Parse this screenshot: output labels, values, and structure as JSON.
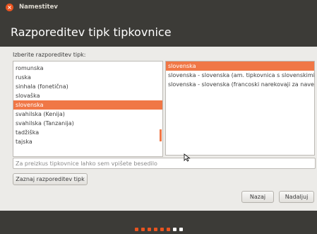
{
  "window": {
    "title": "Namestitev"
  },
  "page": {
    "title": "Razporeditev tipk tipkovnice",
    "prompt": "Izberite razporeditev tipk:"
  },
  "layouts": [
    "romunska",
    "ruska",
    "sinhala (fonetična)",
    "slovaška",
    "slovenska",
    "svahilska (Kenija)",
    "svahilska (Tanzanija)",
    "tadžiška",
    "tajska"
  ],
  "selected_layout": "slovenska",
  "variants": [
    "slovenska",
    "slovenska - slovenska (am. tipkovnica s slovenskimi č",
    "slovenska - slovenska (francoski narekovaji za navedl"
  ],
  "selected_variant": "slovenska",
  "test_field": {
    "placeholder": "Za preizkus tipkovnice lahko sem vpišete besedilo"
  },
  "buttons": {
    "detect": "Zaznaj razporeditev tipk",
    "back": "Nazaj",
    "next": "Nadaljuj"
  },
  "progress": {
    "total": 8,
    "completed": 6
  },
  "colors": {
    "accent": "#f07746",
    "dark": "#3c3b37",
    "dot_done": "#e95420",
    "dot_todo": "#ffffff"
  }
}
